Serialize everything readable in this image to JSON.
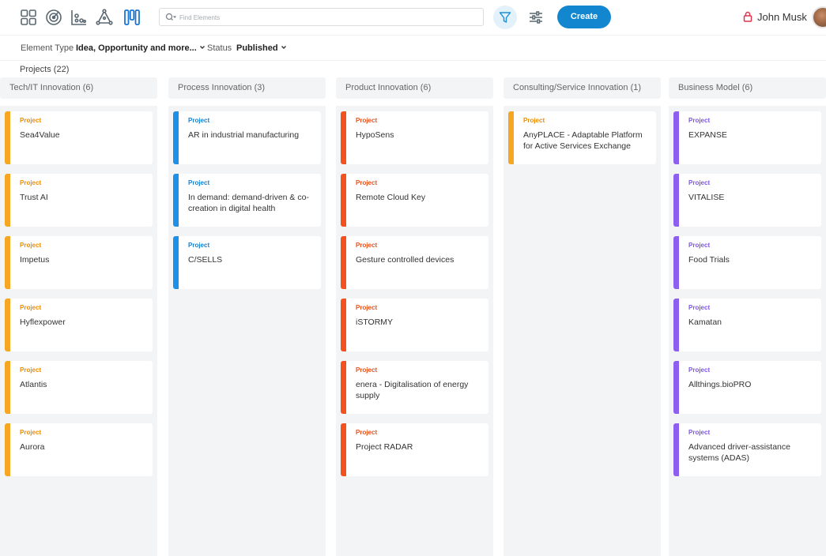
{
  "toolbar": {
    "view_icons": [
      "grid-view-icon",
      "radar-view-icon",
      "chart-view-icon",
      "network-view-icon",
      "kanban-view-icon"
    ],
    "search_placeholder": "Find Elements",
    "create_label": "Create",
    "user_name": "John Musk"
  },
  "filters": {
    "element_type_label": "Element Type",
    "element_type_value": "Idea, Opportunity and more...",
    "status_label": "Status",
    "status_value": "Published"
  },
  "summary": {
    "projects_count": "Projects (22)"
  },
  "colors": {
    "accent": "#1287d0",
    "orange": "#f39c12",
    "blue": "#1e90e8",
    "red_orange": "#f4511e",
    "purple": "#8c5ff1",
    "lock": "#e0344f"
  },
  "columns": [
    {
      "title": "Tech/IT Innovation (6)",
      "color": "#f5a623",
      "type_color": "#ee8c00",
      "cards": [
        {
          "type": "Project",
          "title": "Sea4Value"
        },
        {
          "type": "Project",
          "title": "Trust AI"
        },
        {
          "type": "Project",
          "title": "Impetus"
        },
        {
          "type": "Project",
          "title": "Hyflexpower"
        },
        {
          "type": "Project",
          "title": "Atlantis"
        },
        {
          "type": "Project",
          "title": "Aurora"
        }
      ]
    },
    {
      "title": "Process Innovation (3)",
      "color": "#1e90e8",
      "type_color": "#1480d0",
      "cards": [
        {
          "type": "Project",
          "title": "AR in industrial manufacturing"
        },
        {
          "type": "Project",
          "title": "In demand: demand-driven & co-creation in digital health"
        },
        {
          "type": "Project",
          "title": "C/SELLS"
        }
      ]
    },
    {
      "title": "Product Innovation (6)",
      "color": "#f4511e",
      "type_color": "#e8501a",
      "cards": [
        {
          "type": "Project",
          "title": "HypoSens"
        },
        {
          "type": "Project",
          "title": "Remote Cloud Key"
        },
        {
          "type": "Project",
          "title": "Gesture controlled devices"
        },
        {
          "type": "Project",
          "title": "iSTORMY"
        },
        {
          "type": "Project",
          "title": "enera - Digitalisation of energy supply"
        },
        {
          "type": "Project",
          "title": "Project RADAR"
        }
      ]
    },
    {
      "title": "Consulting/Service Innovation (1)",
      "color": "#f5a623",
      "type_color": "#ee8c00",
      "cards": [
        {
          "type": "Project",
          "title": "AnyPLACE - Adaptable Platform for Active Services Exchange"
        }
      ]
    },
    {
      "title": "Business Model (6)",
      "color": "#8c5ff1",
      "type_color": "#7e57e0",
      "cards": [
        {
          "type": "Project",
          "title": "EXPANSE"
        },
        {
          "type": "Project",
          "title": "VITALISE"
        },
        {
          "type": "Project",
          "title": "Food Trials"
        },
        {
          "type": "Project",
          "title": "Kamatan"
        },
        {
          "type": "Project",
          "title": "Allthings.bioPRO"
        },
        {
          "type": "Project",
          "title": "Advanced driver-assistance systems (ADAS)"
        }
      ]
    }
  ]
}
